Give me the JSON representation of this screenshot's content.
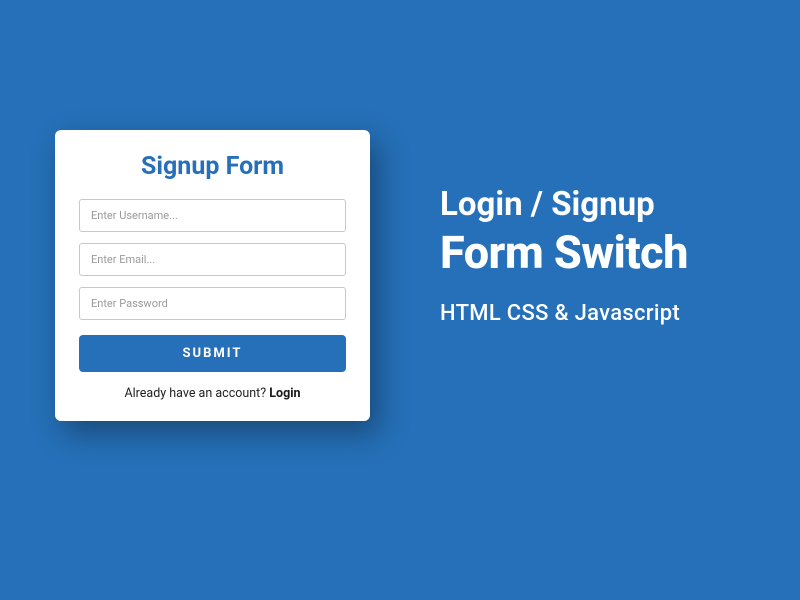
{
  "form": {
    "title": "Signup Form",
    "username_placeholder": "Enter Username...",
    "email_placeholder": "Enter Email...",
    "password_placeholder": "Enter Password",
    "submit_label": "SUBMIT",
    "switch_prompt": "Already have an account? ",
    "switch_link": "Login"
  },
  "hero": {
    "line1": "Login / Signup",
    "line2": "Form Switch",
    "subtitle": "HTML CSS & Javascript"
  },
  "colors": {
    "primary": "#2570b8",
    "card_bg": "#ffffff"
  }
}
